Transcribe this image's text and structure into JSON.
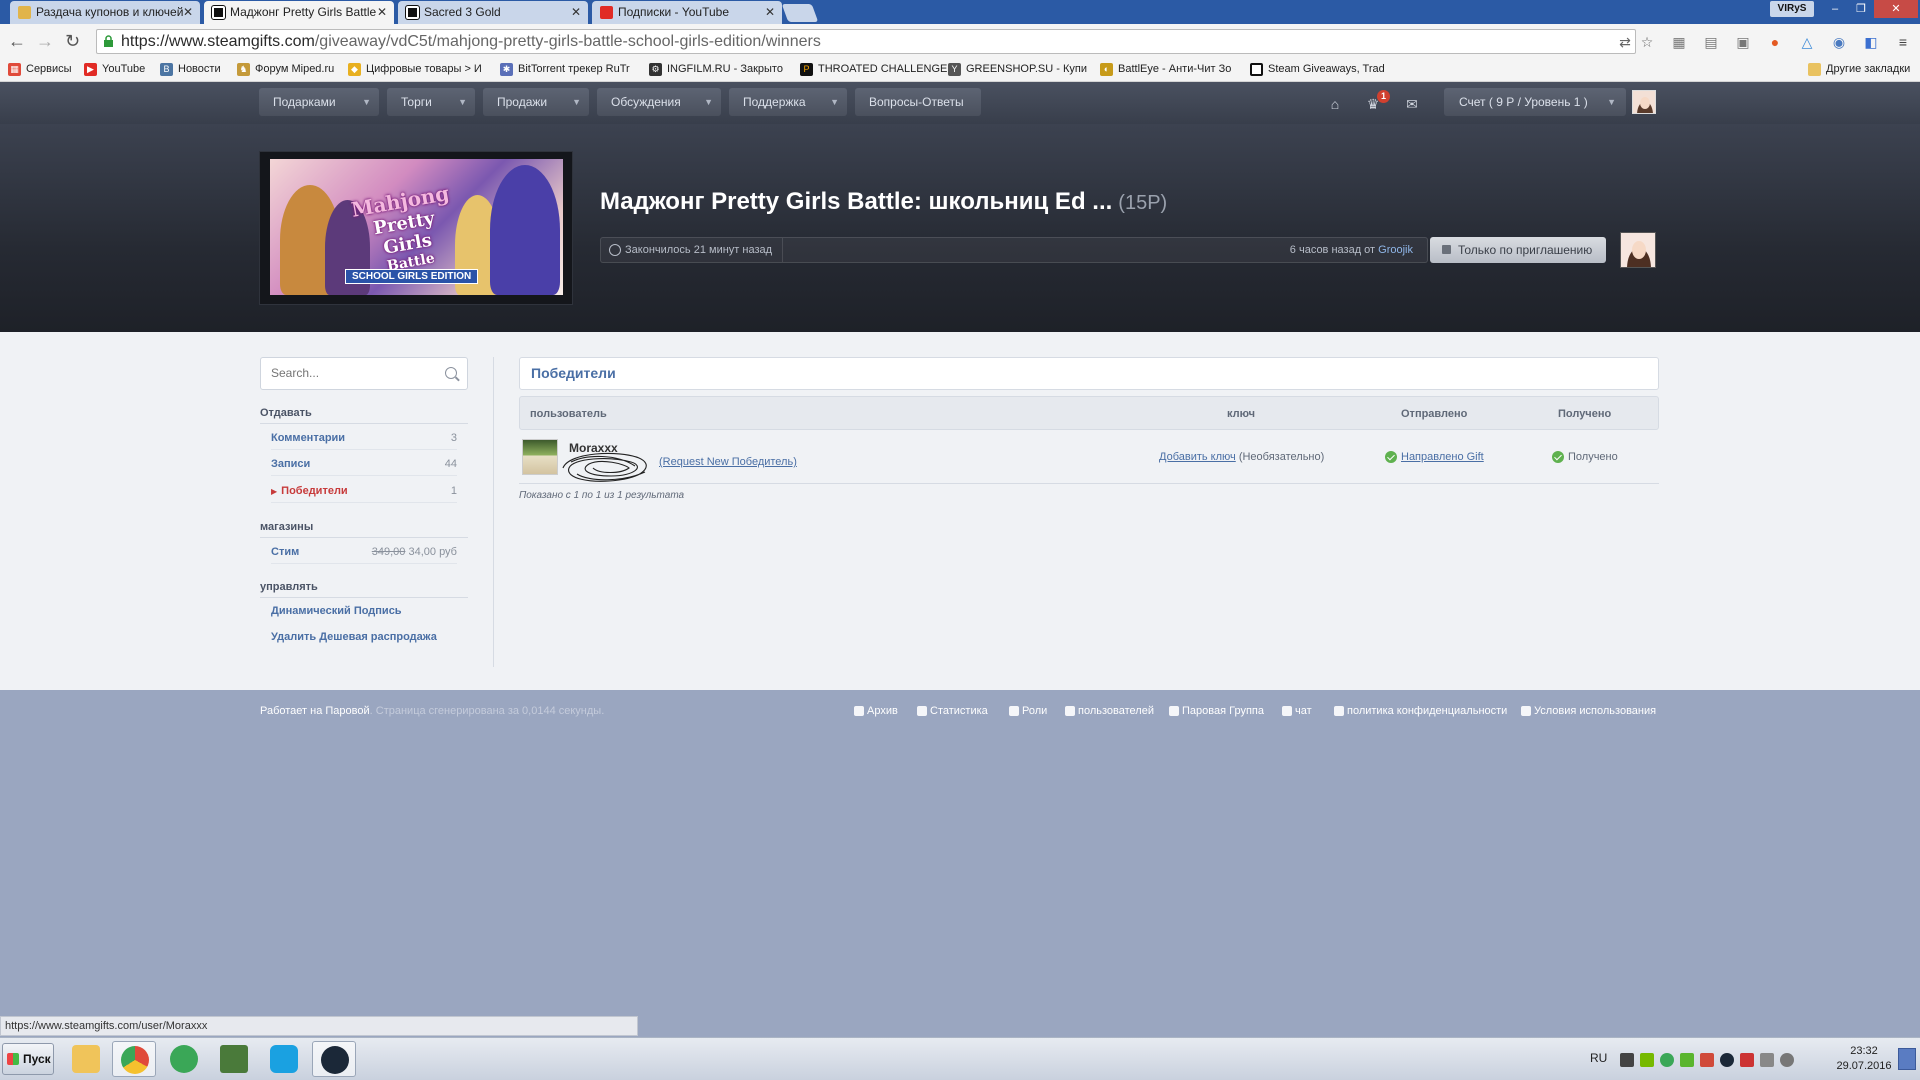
{
  "browser": {
    "tabs": [
      {
        "label": "Раздача купонов и ключей",
        "active": false,
        "icon": "tent-icon"
      },
      {
        "label": "Маджонг Pretty Girls Battle",
        "active": true,
        "icon": "steamgifts-icon"
      },
      {
        "label": "Sacred 3 Gold",
        "active": false,
        "icon": "steamgifts-icon"
      },
      {
        "label": "Подписки - YouTube",
        "active": false,
        "icon": "youtube-icon"
      }
    ],
    "window_user": "VIRyS",
    "url_domain": "https://www.steamgifts.com",
    "url_path": "/giveaway/vdC5t/mahjong-pretty-girls-battle-school-girls-edition/winners",
    "bookmarks": [
      "Сервисы",
      "YouTube",
      "Новости",
      "Форум Miped.ru",
      "Цифровые товары > И",
      "BitTorrent трекер RuTr",
      "INGFILM.RU - Закрыто",
      "THROATED CHALLENGE",
      "GREENSHOP.SU - Купи",
      "BattlEye - Анти-Чит Зо",
      "Steam Giveaways, Trad"
    ],
    "other_bookmarks": "Другие закладки",
    "status_url": "https://www.steamgifts.com/user/Moraxxx"
  },
  "site_nav": {
    "items": [
      "Подарками",
      "Торги",
      "Продажи",
      "Обсуждения",
      "Поддержка",
      "Вопросы-Ответы"
    ],
    "notification_count": "1",
    "account": "Счет ( 9 Р / Уровень 1 )"
  },
  "giveaway": {
    "title": "Маджонг Pretty Girls Battle: школьниц Ed ...",
    "points": "(15P)",
    "ended": "Закончилось 21 минут назад",
    "created_prefix": "6 часов назад от",
    "creator": "Groojik",
    "invite_only": "Только по приглашению",
    "image_text": {
      "line1": "Mahjong",
      "line2": "Pretty Girls",
      "line3": "Battle",
      "edition": "SCHOOL GIRLS EDITION"
    }
  },
  "sidebar": {
    "search_placeholder": "Search...",
    "sections": [
      {
        "heading": "Отдавать",
        "items": [
          {
            "label": "Комментарии",
            "count": "3"
          },
          {
            "label": "Записи",
            "count": "44"
          },
          {
            "label": "Победители",
            "count": "1",
            "active": true
          }
        ]
      },
      {
        "heading": "магазины",
        "items": [
          {
            "label": "Стим",
            "old_price": "349,00",
            "price": "34,00 руб"
          }
        ]
      },
      {
        "heading": "управлять",
        "items": [
          {
            "label": "Динамический Подпись"
          },
          {
            "label": "Удалить Дешевая распродажа"
          }
        ]
      }
    ]
  },
  "winners": {
    "title": "Победители",
    "columns": [
      "пользователь",
      "ключ",
      "Отправлено",
      "Получено"
    ],
    "rows": [
      {
        "user": "Moraxxx",
        "request": "(Request New Победитель)",
        "add_key": "Добавить ключ",
        "optional": "(Необязательно)",
        "sent": "Направлено Gift",
        "received": "Получено"
      }
    ],
    "results": "Показано с 1 по 1 из 1 результата"
  },
  "footer": {
    "powered": "Работает на Паровой",
    "generated": ". Страница сгенерирована за 0,0144 секунды.",
    "links": [
      "Архив",
      "Статистика",
      "Роли",
      "пользователей",
      "Паровая Группа",
      "чат",
      "политика конфиденциальности",
      "Условия использования"
    ]
  },
  "taskbar": {
    "start": "Пуск",
    "lang": "RU",
    "time": "23:32",
    "date": "29.07.2016"
  },
  "colors": {
    "accent": "#4a6fa5",
    "tab_bar": "#2b5aa5",
    "footer_bg": "#9aa6c0",
    "active_red": "#c73b3b"
  }
}
